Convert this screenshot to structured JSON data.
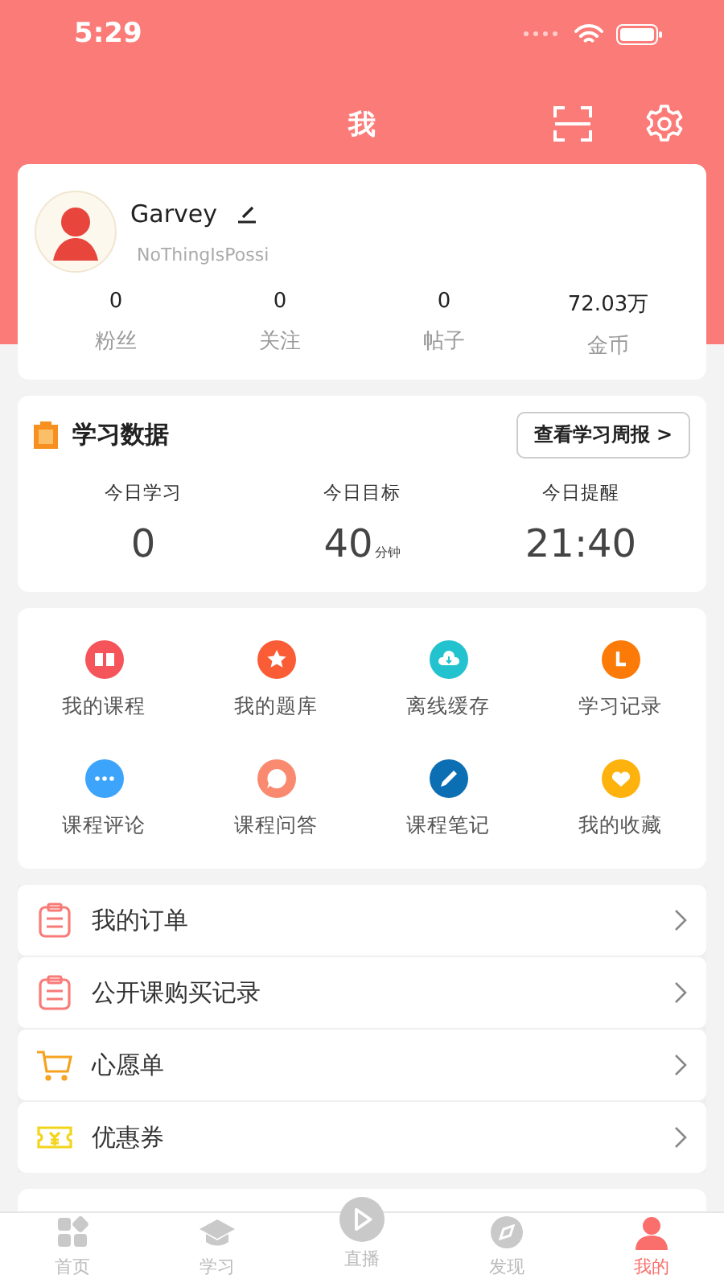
{
  "status_bar": {
    "time": "5:29"
  },
  "header": {
    "title": "我"
  },
  "profile": {
    "name": "Garvey",
    "handle": "NoThingIsPossi",
    "stats": [
      {
        "value": "0",
        "label": "粉丝"
      },
      {
        "value": "0",
        "label": "关注"
      },
      {
        "value": "0",
        "label": "帖子"
      },
      {
        "value": "72.03万",
        "label": "金币"
      }
    ]
  },
  "study": {
    "title": "学习数据",
    "report_button": "查看学习周报 >",
    "metrics": [
      {
        "label": "今日学习",
        "value": "0"
      },
      {
        "label": "今日目标",
        "value": "40",
        "unit": "分钟"
      },
      {
        "label": "今日提醒",
        "value": "21:40"
      }
    ]
  },
  "shortcuts": [
    {
      "label": "我的课程",
      "kind": "book",
      "color": "#f5545a"
    },
    {
      "label": "我的题库",
      "kind": "star",
      "color": "#fa5d35"
    },
    {
      "label": "离线缓存",
      "kind": "download",
      "color": "#22c3cf"
    },
    {
      "label": "学习记录",
      "kind": "clock",
      "color": "#fb7a08"
    },
    {
      "label": "课程评论",
      "kind": "dots",
      "color": "#3da4fb"
    },
    {
      "label": "课程问答",
      "kind": "question",
      "color": "#f98a70"
    },
    {
      "label": "课程笔记",
      "kind": "pencil",
      "color": "#0d6fb3"
    },
    {
      "label": "我的收藏",
      "kind": "heart",
      "color": "#fdb20d"
    }
  ],
  "menu": [
    {
      "label": "我的订单",
      "kind": "order",
      "color": "#f87b78"
    },
    {
      "label": "公开课购买记录",
      "kind": "order",
      "color": "#f87b78"
    },
    {
      "label": "心愿单",
      "kind": "cart",
      "color": "#f6a21f"
    },
    {
      "label": "优惠券",
      "kind": "coupon",
      "color": "#f2d51a"
    }
  ],
  "tab_bar": [
    {
      "label": "首页",
      "kind": "home",
      "selected": false
    },
    {
      "label": "学习",
      "kind": "cap",
      "selected": false
    },
    {
      "label": "直播",
      "kind": "live",
      "selected": false
    },
    {
      "label": "发现",
      "kind": "compass",
      "selected": false
    },
    {
      "label": "我的",
      "kind": "user",
      "selected": true
    }
  ]
}
